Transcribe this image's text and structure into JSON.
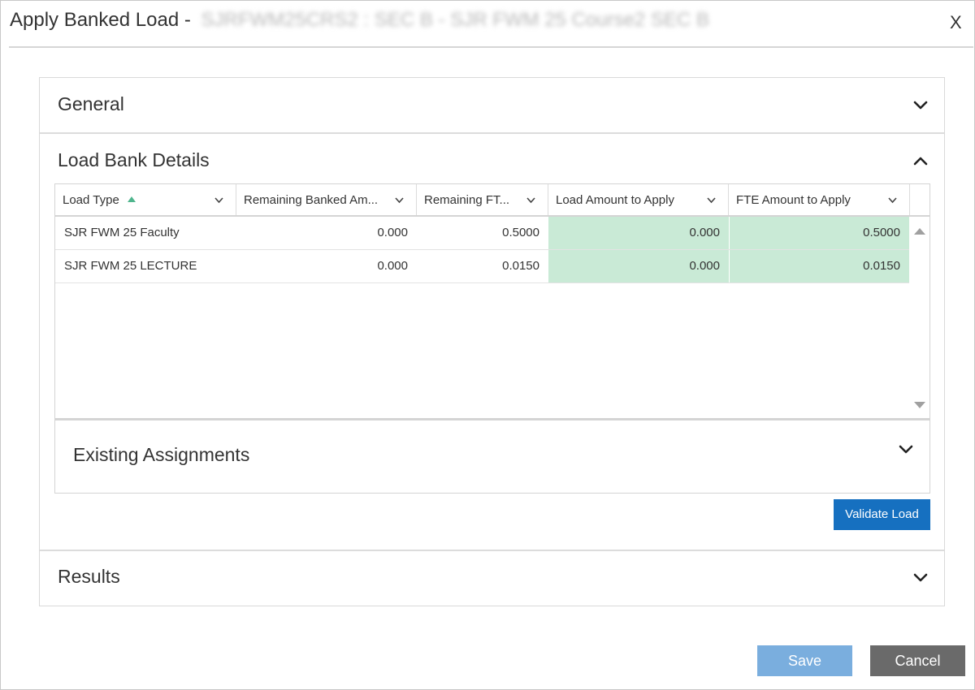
{
  "dialog": {
    "title": "Apply Banked Load -",
    "title_obscured": "SJRFWM25CRS2 : SEC B - SJR FWM 25 Course2 SEC B",
    "close_label": "X"
  },
  "sections": {
    "general": {
      "label": "General",
      "icon": "chevron-down-icon"
    },
    "load_bank": {
      "label": "Load Bank Details",
      "icon": "chevron-up-icon"
    },
    "existing": {
      "label": "Existing Assignments",
      "icon": "chevron-down-icon"
    },
    "results": {
      "label": "Results",
      "icon": "chevron-down-icon"
    }
  },
  "grid": {
    "columns": [
      "Load Type",
      "Remaining Banked Am...",
      "Remaining FT...",
      "Load Amount to Apply",
      "FTE Amount to Apply"
    ],
    "sort_indicator": "sort-ascending-icon",
    "rows": [
      {
        "load_type": "SJR FWM 25 Faculty",
        "remaining_banked": "0.000",
        "remaining_fte": "0.5000",
        "load_amount": "0.000",
        "fte_amount": "0.5000"
      },
      {
        "load_type": "SJR FWM 25 LECTURE",
        "remaining_banked": "0.000",
        "remaining_fte": "0.0150",
        "load_amount": "0.000",
        "fte_amount": "0.0150"
      }
    ]
  },
  "buttons": {
    "validate": "Validate Load",
    "save": "Save",
    "cancel": "Cancel"
  },
  "colors": {
    "editable_cell": "#c9ead6",
    "primary_button": "#1670c0",
    "save_button_disabled": "#7aaede",
    "cancel_button": "#6a6a6a",
    "sort_arrow": "#4fb58d"
  }
}
